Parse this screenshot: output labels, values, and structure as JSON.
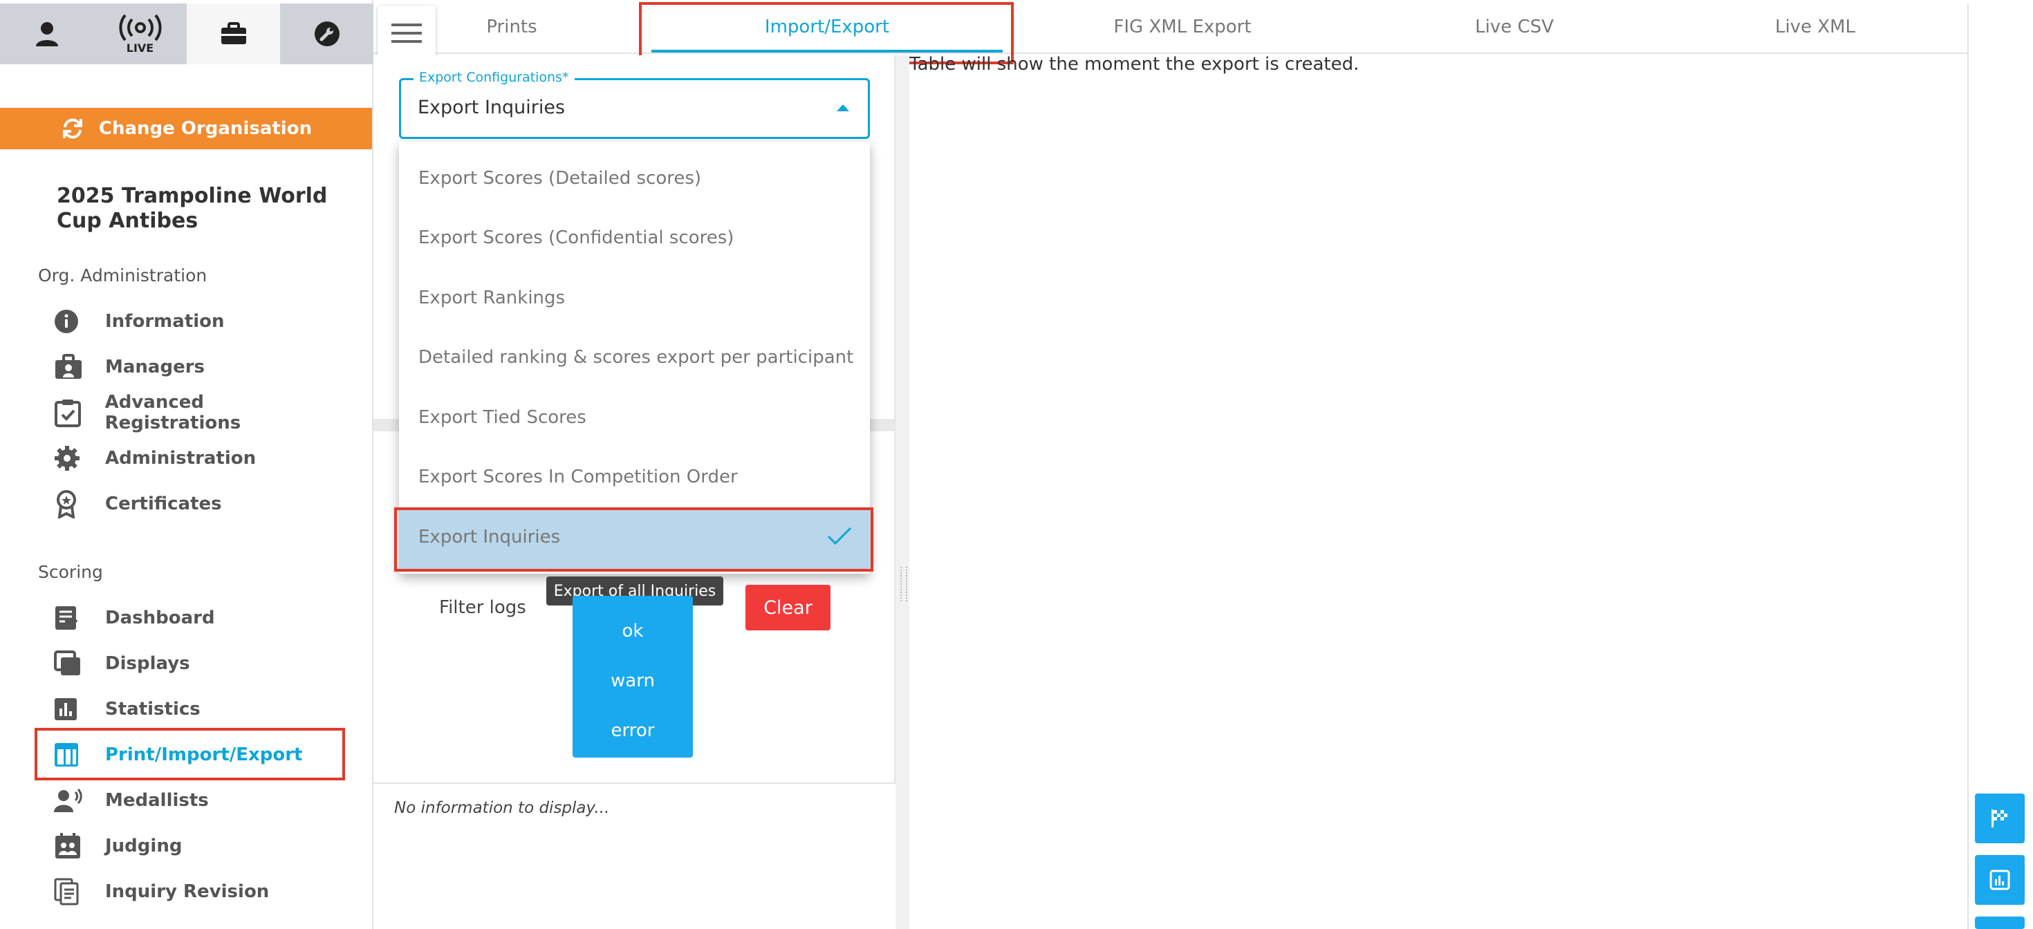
{
  "sidebar": {
    "top_buttons": [
      "user-icon",
      "live-broadcast-icon",
      "briefcase-icon",
      "wrench-icon"
    ],
    "live_label": "LIVE",
    "change_org_label": "Change Organisation",
    "org_title": "2025 Trampoline World Cup Antibes",
    "sections": [
      {
        "title": "Org. Administration",
        "items": [
          {
            "label": "Information",
            "icon": "info-icon"
          },
          {
            "label": "Managers",
            "icon": "briefcase-icon"
          },
          {
            "label": "Advanced Registrations",
            "icon": "clipboard-check-icon"
          },
          {
            "label": "Administration",
            "icon": "gear-icon"
          },
          {
            "label": "Certificates",
            "icon": "award-icon"
          }
        ]
      },
      {
        "title": "Scoring",
        "items": [
          {
            "label": "Dashboard",
            "icon": "dashboard-icon"
          },
          {
            "label": "Displays",
            "icon": "displays-icon"
          },
          {
            "label": "Statistics",
            "icon": "bar-chart-icon"
          },
          {
            "label": "Print/Import/Export",
            "icon": "table-icon",
            "active": true
          },
          {
            "label": "Medallists",
            "icon": "medallist-icon"
          },
          {
            "label": "Judging",
            "icon": "calendar-people-icon"
          },
          {
            "label": "Inquiry Revision",
            "icon": "documents-icon"
          }
        ]
      }
    ]
  },
  "tabs": [
    {
      "label": "Prints"
    },
    {
      "label": "Import/Export",
      "active": true
    },
    {
      "label": "FIG XML Export"
    },
    {
      "label": "Live CSV"
    },
    {
      "label": "Live XML"
    }
  ],
  "export_config": {
    "label": "Export Configurations*",
    "value": "Export Inquiries",
    "options": [
      "Export Scores (Detailed scores)",
      "Export Scores (Confidential scores)",
      "Export Rankings",
      "Detailed ranking & scores export per participant",
      "Export Tied Scores",
      "Export Scores In Competition Order",
      "Export Inquiries"
    ],
    "selected_index": 6,
    "tooltip": "Export of all Inquiries"
  },
  "logs": {
    "filter_label": "Filter logs",
    "levels": [
      "ok",
      "warn",
      "error"
    ],
    "clear_label": "Clear",
    "empty_text": "No information to display..."
  },
  "content": {
    "message": "Table will show the moment the export is created."
  },
  "colors": {
    "accent": "#0ea5d8",
    "orange": "#f28a2e",
    "danger": "#f13a3a",
    "selection": "#b9d6ea",
    "highlight": "#e03a2b"
  }
}
